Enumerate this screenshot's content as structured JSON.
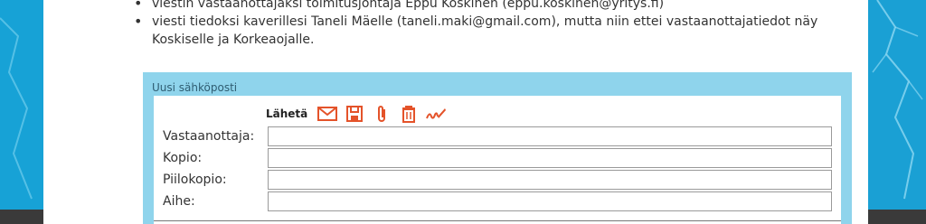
{
  "instructions": {
    "items": [
      "viestin vastaanottajaksi toimitusjohtaja Eppu Koskinen (eppu.koskinen@yritys.fi)",
      "viesti tiedoksi kaverillesi Taneli Mäelle (taneli.maki@gmail.com), mutta niin ettei vastaanottajatiedot näy Koskiselle ja Korkeaojalle."
    ]
  },
  "email": {
    "panel_title": "Uusi sähköposti",
    "toolbar": {
      "send_label": "Lähetä",
      "icons": [
        "envelope-icon",
        "save-icon",
        "attachment-icon",
        "trash-icon",
        "signature-icon"
      ]
    },
    "fields": {
      "to_label": "Vastaanottaja:",
      "to_value": "",
      "cc_label": "Kopio:",
      "cc_value": "",
      "bcc_label": "Piilokopio:",
      "bcc_value": "",
      "subject_label": "Aihe:",
      "subject_value": ""
    }
  },
  "colors": {
    "background": "#1d9fd0",
    "panel": "#8fd4ec",
    "icon_accent": "#e4532a"
  }
}
